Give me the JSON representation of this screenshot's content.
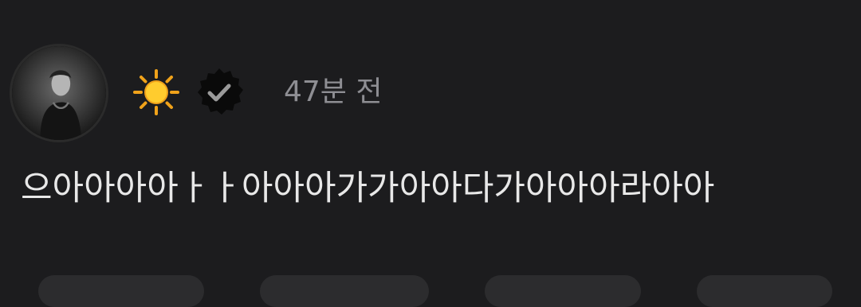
{
  "post": {
    "author_emoji": "☀️",
    "verified": true,
    "timestamp": "47분 전",
    "text": "으아아아아ㅏㅏ아아아가가아아다가아아아라아아"
  },
  "icons": {
    "author_emoji": "sun-icon",
    "verified": "verified-badge-icon"
  },
  "colors": {
    "background": "#1c1c1e",
    "text": "#e8e8e8",
    "muted": "#8e8e93",
    "badge": "#0a0a0a"
  }
}
